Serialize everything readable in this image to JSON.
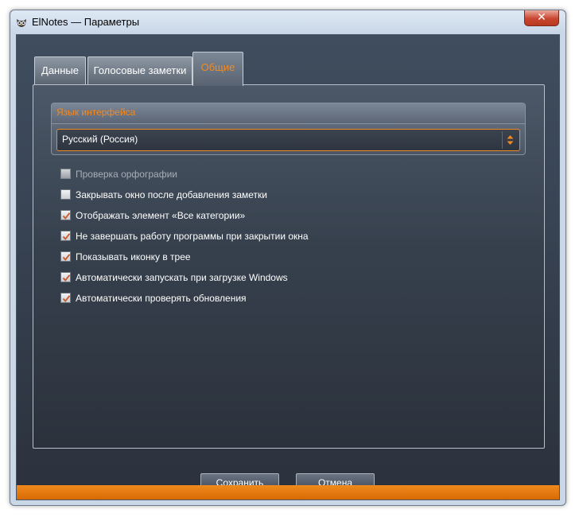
{
  "window": {
    "title": "ElNotes — Параметры",
    "close_glyph": "✕"
  },
  "tabs": [
    {
      "label": "Данные",
      "active": false
    },
    {
      "label": "Голосовые заметки",
      "active": false
    },
    {
      "label": "Общие",
      "active": true
    }
  ],
  "language": {
    "header": "Язык интерфейса",
    "selected": "Русский (Россия)"
  },
  "options": [
    {
      "label": "Проверка орфографии",
      "checked": false,
      "disabled": true
    },
    {
      "label": "Закрывать окно после добавления заметки",
      "checked": false,
      "disabled": false
    },
    {
      "label": "Отображать элемент «Все категории»",
      "checked": true,
      "disabled": false
    },
    {
      "label": "Не завершать работу программы при закрытии окна",
      "checked": true,
      "disabled": false
    },
    {
      "label": "Показывать иконку в трее",
      "checked": true,
      "disabled": false
    },
    {
      "label": "Автоматически запускать при загрузке Windows",
      "checked": true,
      "disabled": false
    },
    {
      "label": "Автоматически проверять обновления",
      "checked": true,
      "disabled": false
    }
  ],
  "buttons": {
    "save": {
      "first": "С",
      "rest": "охранить"
    },
    "cancel": {
      "first": "О",
      "rest": "тмена"
    }
  },
  "colors": {
    "accent": "#f28a22",
    "check": "#c8582a"
  }
}
